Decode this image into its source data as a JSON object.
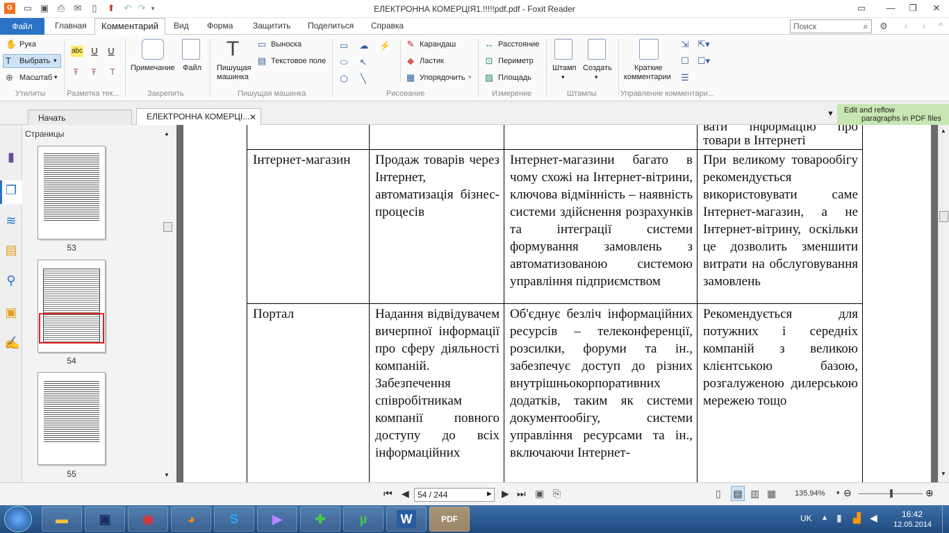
{
  "window": {
    "title": "ЕЛЕКТРОННА КОМЕРЦІЯ1.!!!!!pdf.pdf - Foxit Reader"
  },
  "menu": {
    "tabs": [
      "Файл",
      "Главная",
      "Комментарий",
      "Вид",
      "Форма",
      "Защитить",
      "Поделиться",
      "Справка"
    ],
    "search_placeholder": "Поиск"
  },
  "ribbon": {
    "tools": {
      "hand": "Рука",
      "select": "Выбрать",
      "zoom": "Масштаб",
      "group": "Утилиты"
    },
    "markup": {
      "group": "Разметка тек..."
    },
    "pin": {
      "note": "Примечание",
      "file": "Файл",
      "group": "Закрепить"
    },
    "typewriter": {
      "typewriter_l1": "Пишущая",
      "typewriter_l2": "машинка",
      "callout": "Выноска",
      "textbox": "Текстовое поле",
      "group": "Пишущая машинка"
    },
    "drawing": {
      "pencil": "Карандаш",
      "eraser": "Ластик",
      "arrange": "Упорядочить",
      "group": "Рисование"
    },
    "measure": {
      "distance": "Расстояние",
      "perimeter": "Периметр",
      "area": "Площадь",
      "group": "Измерение"
    },
    "stamps": {
      "stamp": "Штамп",
      "create": "Создать",
      "group": "Штампы"
    },
    "manage": {
      "summary_l1": "Краткие",
      "summary_l2": "комментарии",
      "group": "Управление комментари..."
    }
  },
  "doctabs": {
    "start": "Начать",
    "document": "ЕЛЕКТРОННА КОМЕРЦІ..."
  },
  "promo": {
    "line1": "Edit and reflow",
    "line2": "paragraphs in PDF files"
  },
  "sidebar": {
    "header": "Страницы",
    "pages": [
      "53",
      "54",
      "55"
    ]
  },
  "table": {
    "top_row": [
      "",
      "",
      "",
      "вати інформацію про товари в Інтернеті"
    ],
    "rows": [
      [
        "Інтернет-магазин",
        "Продаж товарів через Інтернет, автоматизація бізнес-процесів",
        "Інтернет-магазини багато в чому схожі на Інтернет-вітрини, ключова відмінність – наявність системи здійснення розрахунків та інтеграції системи формування замовлень з автоматизованою системою управління підприємством",
        "При великому товарообігу рекомендується використовувати саме Інтернет-магазин, а не Інтернет-вітрину, оскільки це дозволить зменшити витрати на обслуговування замовлень"
      ],
      [
        "Портал",
        "Надання відвідувачем вичерпної інформації про сферу діяльності компаній. Забезпечення співробітникам компанії повного доступу до всіх інформаційних",
        "Об'єднує безліч інформаційних ресурсів – телеконференції, розсилки, форуми та ін., забезпечує доступ до різних внутрішньокорпоративних додатків, таким як системи документообігу, системи управління ресурсами та ін., включаючи Інтернет-",
        "Рекомендується для потужних і середніх компаній з великою клієнтською базою, розгалуженою дилерською мережею тощо"
      ]
    ]
  },
  "status": {
    "page_indicator": "54 / 244",
    "zoom": "135.94%"
  },
  "taskbar": {
    "lang": "UK",
    "time": "16:42",
    "date": "12.05.2014"
  },
  "colors": {
    "accent": "#2a72c5",
    "promo": "#c8e6b2",
    "taskbar": "#2b5a92",
    "viewer_bg": "#6b6b6b",
    "selection": "#e02020"
  }
}
